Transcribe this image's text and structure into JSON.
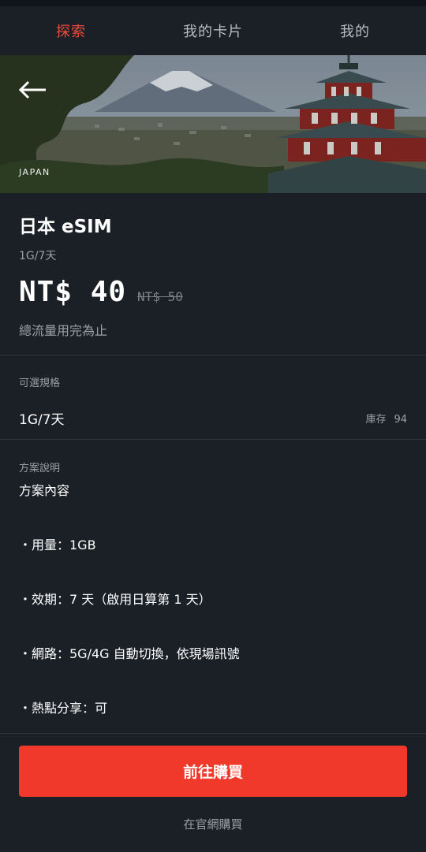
{
  "nav": {
    "tabs": [
      {
        "label": "探索",
        "active": true
      },
      {
        "label": "我的卡片",
        "active": false
      },
      {
        "label": "我的",
        "active": false
      }
    ],
    "active_color": "#f04a3a"
  },
  "hero": {
    "tag": "JAPAN",
    "icon": "back-arrow-icon"
  },
  "product": {
    "title": "日本 eSIM",
    "subtitle": "1G/7天",
    "price": "NT$ 40",
    "old_price": "NT$ 50",
    "note": "總流量用完為止"
  },
  "spec": {
    "label": "可選規格",
    "value": "1G/7天",
    "stock_label": "庫存",
    "stock_count": "94"
  },
  "description": {
    "label": "方案說明",
    "lines": [
      "方案內容",
      "・用量：1GB",
      "・效期：7 天（啟用日算第 1 天）",
      "・網路：5G/4G 自動切換，依現場訊號",
      "・熱點分享：可"
    ]
  },
  "footer": {
    "buy_label": "前往購買",
    "site_link": "在官網購買",
    "buy_color": "#f0392b"
  }
}
